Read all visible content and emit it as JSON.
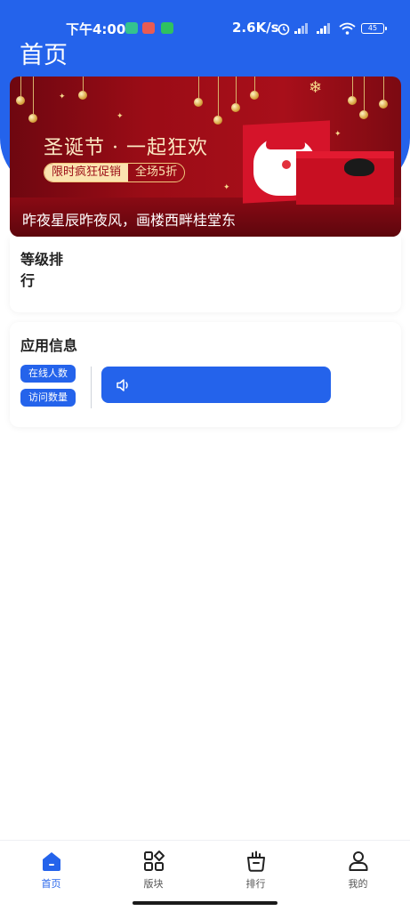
{
  "status_bar": {
    "time": "下午4:00",
    "network_speed": "2.6K/s",
    "battery": "45"
  },
  "header": {
    "title": "首页"
  },
  "banner": {
    "headline": "圣诞节 · 一起狂欢",
    "pill_left": "限时疯狂促销",
    "pill_right": "全场5折",
    "caption": "昨夜星辰昨夜风，画楼西畔桂堂东"
  },
  "rank_card": {
    "title": "等级排行"
  },
  "info_card": {
    "title": "应用信息",
    "online_tag": "在线人数",
    "visits_tag": "访问数量",
    "notice_icon": "speaker-icon"
  },
  "tabbar": {
    "items": [
      {
        "label": "首页",
        "icon": "home-icon",
        "active": true
      },
      {
        "label": "版块",
        "icon": "grid-icon",
        "active": false
      },
      {
        "label": "排行",
        "icon": "leaderboard-icon",
        "active": false
      },
      {
        "label": "我的",
        "icon": "user-icon",
        "active": false
      }
    ]
  },
  "colors": {
    "primary": "#2463eb",
    "banner_red": "#9b0c16"
  }
}
